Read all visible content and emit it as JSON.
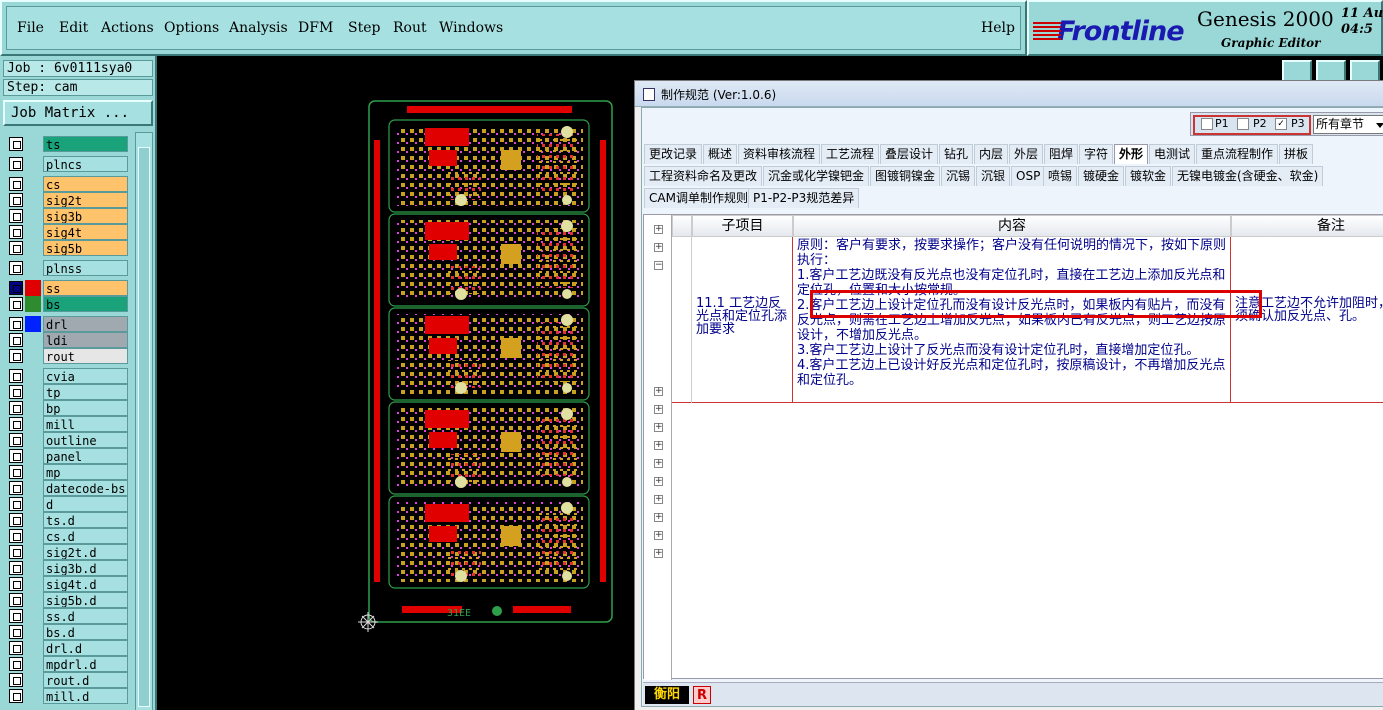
{
  "menubar": {
    "items": [
      {
        "label": "File",
        "u": "F"
      },
      {
        "label": "Edit",
        "u": "E"
      },
      {
        "label": "Actions",
        "u": "A"
      },
      {
        "label": "Options",
        "u": "O"
      },
      {
        "label": "Analysis",
        "u": "A"
      },
      {
        "label": "DFM",
        "u": ""
      },
      {
        "label": "Step",
        "u": "S"
      },
      {
        "label": "Rout",
        "u": "R"
      },
      {
        "label": "Windows",
        "u": "W"
      }
    ],
    "help": "Help"
  },
  "logo": {
    "brand": "Frontline",
    "product": "Genesis 2000",
    "subtitle": "Graphic Editor",
    "datetime": "11 Au\n04:5"
  },
  "job": {
    "label": "Job : 6v0111sya0",
    "step": "Step: cam",
    "matrix_button": "Job Matrix ..."
  },
  "layers": [
    {
      "name": "ts",
      "color": "#1aa37a"
    },
    {
      "name": "plncs",
      "color": "#a6e0e0"
    },
    {
      "name": "cs",
      "color": "#ffc36b"
    },
    {
      "name": "sig2t",
      "color": "#ffc36b"
    },
    {
      "name": "sig3b",
      "color": "#ffc36b"
    },
    {
      "name": "sig4t",
      "color": "#ffc36b"
    },
    {
      "name": "sig5b",
      "color": "#ffc36b"
    },
    {
      "name": "plnss",
      "color": "#a6e0e0"
    },
    {
      "name": "ss",
      "color": "#ffc36b",
      "swatch": "#e00000",
      "active": true
    },
    {
      "name": "bs",
      "color": "#1aa37a",
      "swatch": "#2e8b2e"
    },
    {
      "name": "drl",
      "color": "#a0a8b0",
      "swatch": "#0022ff"
    },
    {
      "name": "ldi",
      "color": "#a0a8b0"
    },
    {
      "name": "rout",
      "color": "#e6e6e6"
    },
    {
      "name": "cvia",
      "color": "#a6e0e0"
    },
    {
      "name": "tp",
      "color": "#a6e0e0"
    },
    {
      "name": "bp",
      "color": "#a6e0e0"
    },
    {
      "name": "mill",
      "color": "#a6e0e0"
    },
    {
      "name": "outline",
      "color": "#a6e0e0"
    },
    {
      "name": "panel",
      "color": "#a6e0e0"
    },
    {
      "name": "mp",
      "color": "#a6e0e0"
    },
    {
      "name": "datecode-bs",
      "color": "#a6e0e0"
    },
    {
      "name": "d",
      "color": "#a6e0e0"
    },
    {
      "name": "ts.d",
      "color": "#a6e0e0"
    },
    {
      "name": "cs.d",
      "color": "#a6e0e0"
    },
    {
      "name": "sig2t.d",
      "color": "#a6e0e0"
    },
    {
      "name": "sig3b.d",
      "color": "#a6e0e0"
    },
    {
      "name": "sig4t.d",
      "color": "#a6e0e0"
    },
    {
      "name": "sig5b.d",
      "color": "#a6e0e0"
    },
    {
      "name": "ss.d",
      "color": "#a6e0e0"
    },
    {
      "name": "bs.d",
      "color": "#a6e0e0"
    },
    {
      "name": "drl.d",
      "color": "#a6e0e0"
    },
    {
      "name": "mpdrl.d",
      "color": "#a6e0e0"
    },
    {
      "name": "rout.d",
      "color": "#a6e0e0"
    },
    {
      "name": "mill.d",
      "color": "#a6e0e0"
    }
  ],
  "canvas": {
    "silk_text": "31EE"
  },
  "dialog": {
    "title": "制作规范 (Ver:1.0.6)",
    "options": {
      "p1": "P1",
      "p2": "P2",
      "p3": "P3",
      "chapter": "所有章节"
    },
    "tabs_row1": [
      "更改记录",
      "概述",
      "资料审核流程",
      "工艺流程",
      "叠层设计",
      "钻孔",
      "内层",
      "外层",
      "阻焊",
      "字符",
      "外形",
      "电测试",
      "重点流程制作",
      "拼板"
    ],
    "tabs_row2": [
      "工程资料命名及更改",
      "沉金或化学镍钯金",
      "图镀铜镍金",
      "沉锡",
      "沉银",
      "OSP",
      "喷锡",
      "镀硬金",
      "镀软金",
      "无镍电镀金(含硬金、软金)"
    ],
    "tabs_row3": [
      "CAM调单制作规则",
      "P1-P2-P3规范差异"
    ],
    "active_tab": "外形",
    "table": {
      "headers": [
        "子项目",
        "内容",
        "备注"
      ],
      "row": {
        "subitem": "11.1 工艺边反光点和定位孔添加要求",
        "content": [
          "原则：客户有要求，按要求操作；客户没有任何说明的情况下，按如下原则执行：",
          "1.客户工艺边既没有反光点也没有定位孔时，直接在工艺边上添加反光点和定位孔，位置和大小按常规。",
          "2.客户工艺边上设计定位孔而没有设计反光点时，如果板内有贴片，而没有反光点，则需在工艺边上增加反光点；如果板内已有反光点，则工艺边按原设计，不增加反光点。",
          "3.客户工艺边上设计了反光点而没有设计定位孔时，直接增加定位孔。",
          "4.客户工艺边上已设计好反光点和定位孔时，按原稿设计，不再增加反光点和定位孔。"
        ],
        "note": "注意工艺边不允许加阻时，须确认加反光点、孔。"
      }
    },
    "status": {
      "location": "衡阳",
      "mark": "R"
    }
  }
}
